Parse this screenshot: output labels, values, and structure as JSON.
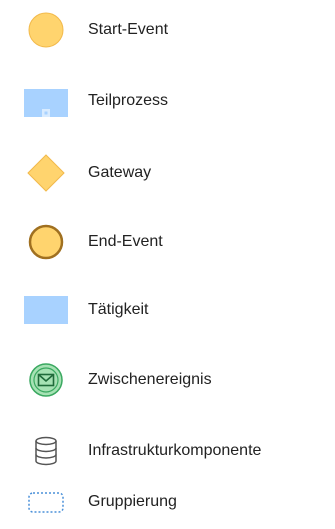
{
  "legend": {
    "items": [
      {
        "label": "Start-Event",
        "icon": "start-event-icon",
        "fill": "#ffd46e"
      },
      {
        "label": "Teilprozess",
        "icon": "subprocess-icon",
        "fill": "#a8d2ff"
      },
      {
        "label": "Gateway",
        "icon": "gateway-icon",
        "fill": "#ffd46e"
      },
      {
        "label": "End-Event",
        "icon": "end-event-icon",
        "fill": "#ffd46e",
        "stroke": "#b07c1c"
      },
      {
        "label": "Tätigkeit",
        "icon": "activity-icon",
        "fill": "#a8d2ff"
      },
      {
        "label": "Zwischenereignis",
        "icon": "intermediate-event-icon",
        "fill": "#9fdfb0",
        "stroke": "#2ea25a"
      },
      {
        "label": "Infrastrukturkomponente",
        "icon": "database-icon",
        "stroke": "#555555"
      },
      {
        "label": "Gruppierung",
        "icon": "group-icon",
        "stroke": "#4a90d9"
      }
    ]
  }
}
